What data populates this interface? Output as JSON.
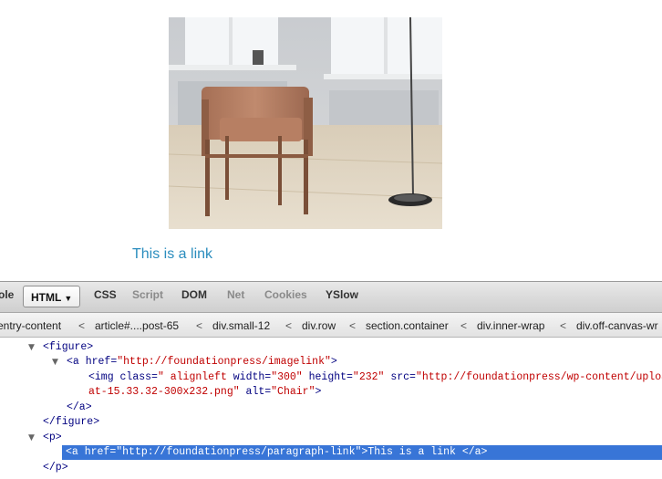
{
  "page": {
    "image_alt": "Chair",
    "link_text": "This is a link"
  },
  "devtools": {
    "tabs": [
      {
        "label": "ole"
      },
      {
        "label": "HTML",
        "active": true
      },
      {
        "label": "CSS"
      },
      {
        "label": "Script"
      },
      {
        "label": "DOM"
      },
      {
        "label": "Net"
      },
      {
        "label": "Cookies"
      },
      {
        "label": "YSlow"
      }
    ],
    "breadcrumbs": [
      "entry-content",
      "article#....post-65",
      "div.small-12",
      "div.row",
      "section.container",
      "div.inner-wrap",
      "div.off-canvas-wr"
    ],
    "tree": {
      "figure_open": "<figure>",
      "a_open_tag": "<a",
      "href_attr": "href=",
      "href_value": "\"http://foundationpress/imagelink\"",
      "gt": ">",
      "img_open": "<img",
      "class_attr": "class=",
      "class_value": "\" alignleft",
      "width_attr": "width=",
      "width_value": "\"300\"",
      "height_attr": "height=",
      "height_value": "\"232\"",
      "src_attr": "src=",
      "src_value": "\"http://foundationpress/wp-content/uploads/",
      "src_value_cont": "at-15.33.32-300x232.png\"",
      "alt_attr": "alt=",
      "alt_value": "\"Chair\"",
      "a_close": "</a>",
      "figure_close": "</figure>",
      "p_open": "<p>",
      "sel_a_open": "<a",
      "sel_href_value": "\"http://foundationpress/paragraph-link\"",
      "sel_text": "This is a link",
      "p_close": "</p>"
    }
  }
}
